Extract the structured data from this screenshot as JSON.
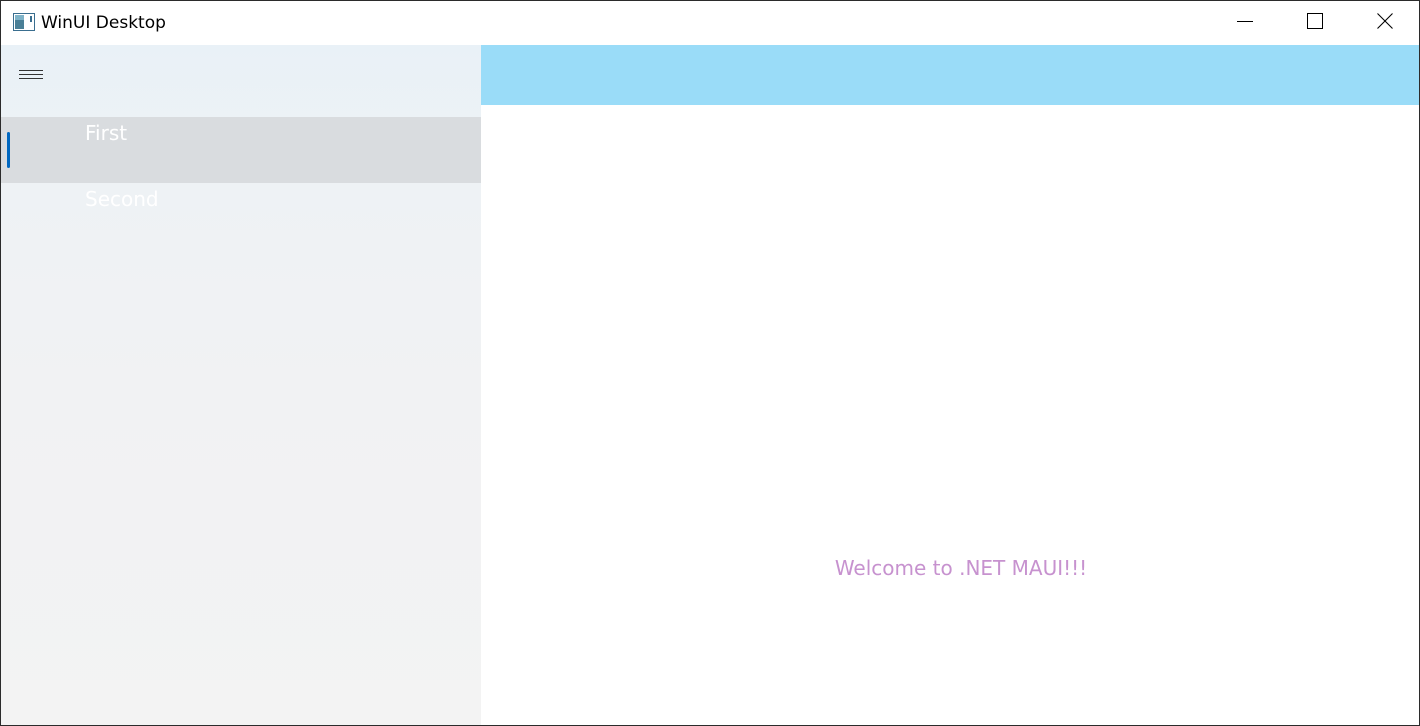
{
  "window": {
    "title": "WinUI Desktop"
  },
  "titlebar": {
    "icons": {
      "app": "app-window-icon",
      "minimize": "minimize-icon",
      "maximize": "maximize-icon",
      "close": "close-icon"
    }
  },
  "nav": {
    "menu_icon": "hamburger-menu-icon",
    "items": [
      {
        "label": "First",
        "selected": true
      },
      {
        "label": "Second",
        "selected": false
      }
    ]
  },
  "content": {
    "header_color": "#9adcf8",
    "message": "Welcome to .NET MAUI!!!",
    "message_color": "#c792cf"
  },
  "colors": {
    "accent": "#0067c0",
    "nav_selected_bg": "#d9dcdf",
    "nav_text": "#ffffff"
  }
}
